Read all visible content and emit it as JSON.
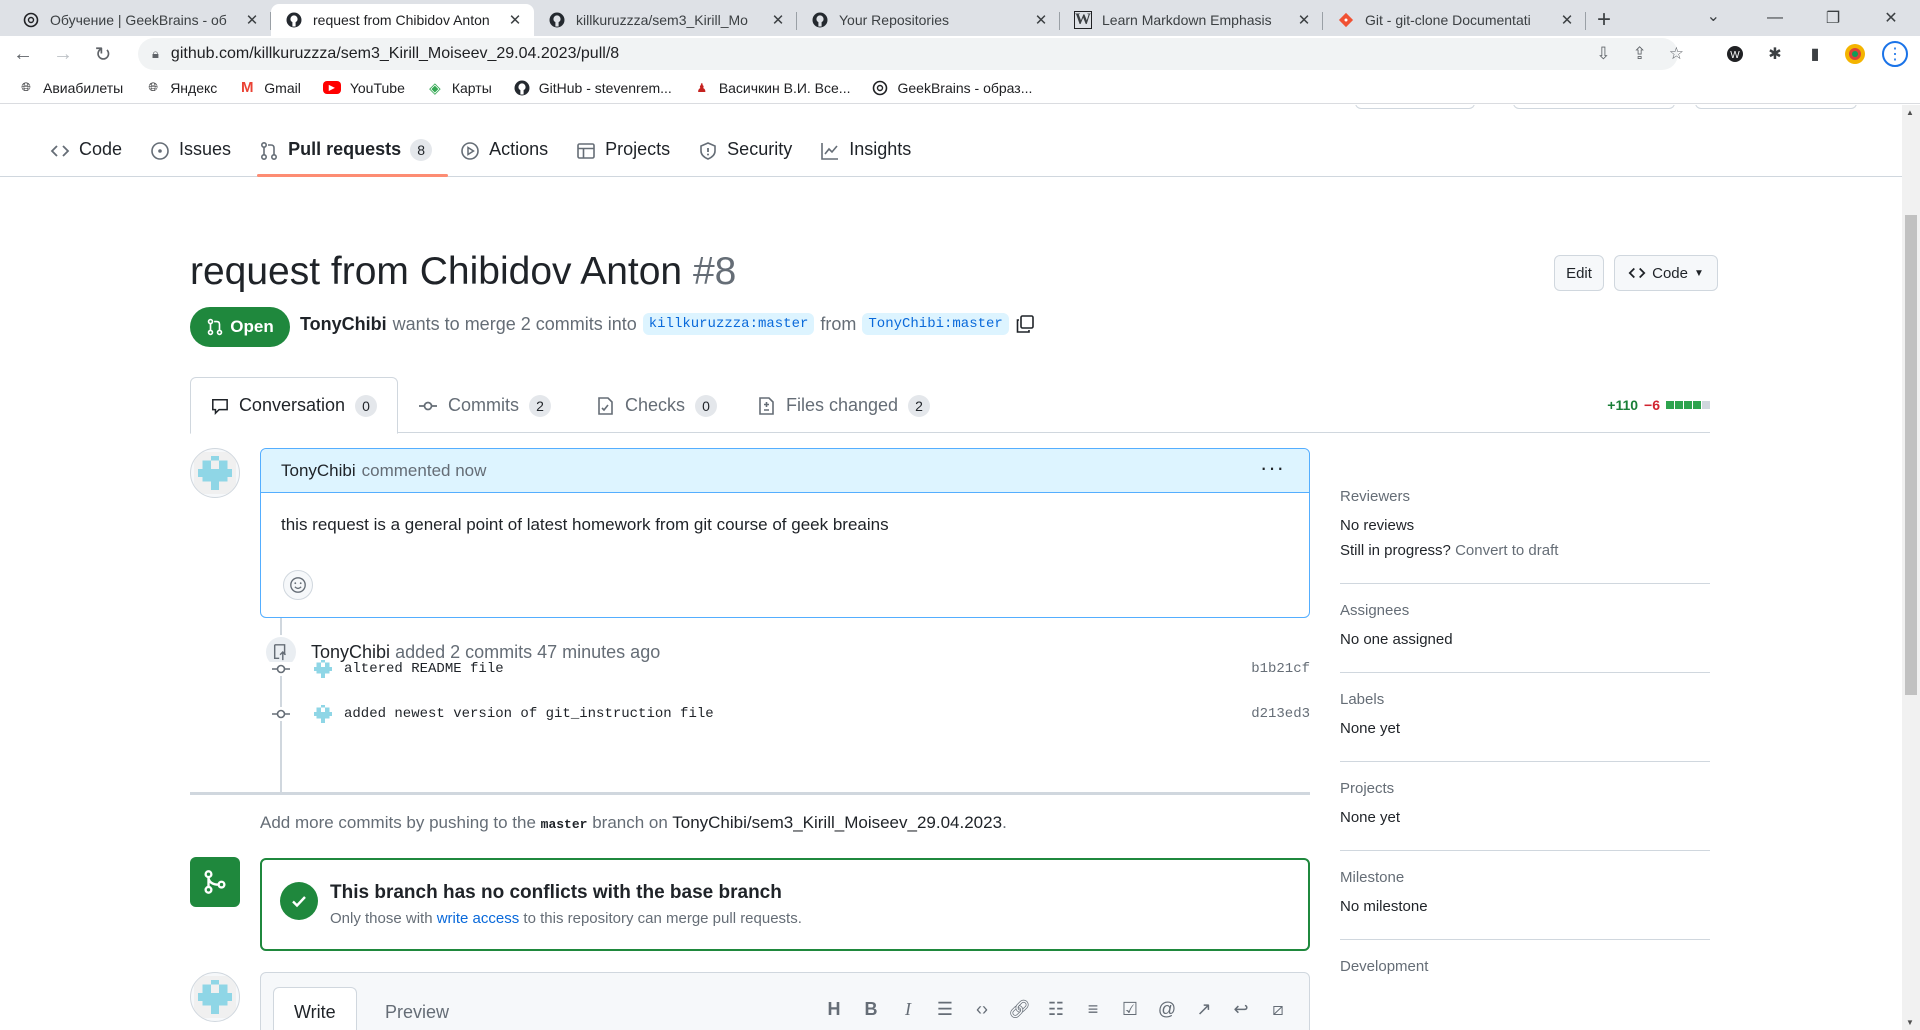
{
  "browser": {
    "tabs": [
      {
        "title": "Обучение | GeekBrains - об",
        "icon": "openai-icon"
      },
      {
        "title": "request from Chibidov Anton",
        "icon": "github-icon",
        "active": true
      },
      {
        "title": "killkuruzzza/sem3_Kirill_Mo",
        "icon": "github-icon"
      },
      {
        "title": "Your Repositories",
        "icon": "github-icon"
      },
      {
        "title": "Learn Markdown Emphasis",
        "icon": "w-icon"
      },
      {
        "title": "Git - git-clone Documentati",
        "icon": "git-icon"
      }
    ],
    "url": "github.com/killkuruzzza/sem3_Kirill_Moiseev_29.04.2023/pull/8",
    "bookmarks": [
      {
        "label": "Авиабилеты",
        "icon": "globe-icon"
      },
      {
        "label": "Яндекс",
        "icon": "globe-icon"
      },
      {
        "label": "Gmail",
        "icon": "gmail-icon"
      },
      {
        "label": "YouTube",
        "icon": "youtube-icon"
      },
      {
        "label": "Карты",
        "icon": "maps-icon"
      },
      {
        "label": "GitHub - stevenrem...",
        "icon": "github-icon"
      },
      {
        "label": "Васичкин В.И. Все...",
        "icon": "person-icon"
      },
      {
        "label": "GeekBrains - образ...",
        "icon": "openai-icon"
      }
    ]
  },
  "repo_nav": {
    "code": "Code",
    "issues": "Issues",
    "pulls": "Pull requests",
    "pulls_count": "8",
    "actions": "Actions",
    "projects": "Projects",
    "security": "Security",
    "insights": "Insights"
  },
  "pr": {
    "title": "request from Chibidov Anton",
    "number": "#8",
    "edit_label": "Edit",
    "code_label": "Code",
    "state": "Open",
    "author": "TonyChibi",
    "merge_text": "wants to merge 2 commits into",
    "base_branch": "killkuruzzza:master",
    "from_text": "from",
    "head_branch": "TonyChibi:master"
  },
  "pr_tabs": {
    "conversation": "Conversation",
    "conversation_count": "0",
    "commits": "Commits",
    "commits_count": "2",
    "checks": "Checks",
    "checks_count": "0",
    "files": "Files changed",
    "files_count": "2",
    "additions": "+110",
    "deletions": "−6",
    "diff_blocks_green": 4,
    "diff_blocks_total": 5
  },
  "comment": {
    "author": "TonyChibi",
    "action": "commented now",
    "body": "this request is a general point of latest homework from git course of geek breains"
  },
  "push_event": {
    "author": "TonyChibi",
    "text": "added 2 commits 47 minutes ago",
    "commits": [
      {
        "message": "altered README file",
        "sha": "b1b21cf"
      },
      {
        "message": "added newest version of git_instruction file",
        "sha": "d213ed3"
      }
    ]
  },
  "add_more": {
    "prefix": "Add more commits by pushing to the",
    "branch": "master",
    "middle": "branch on",
    "repo": "TonyChibi/sem3_Kirill_Moiseev_29.04.2023",
    "suffix": "."
  },
  "merge": {
    "title": "This branch has no conflicts with the base branch",
    "desc_prefix": "Only those with",
    "desc_link": "write access",
    "desc_suffix": "to this repository can merge pull requests."
  },
  "composer": {
    "write": "Write",
    "preview": "Preview"
  },
  "sidebar": {
    "reviewers": "Reviewers",
    "reviewers_value": "No reviews",
    "in_progress": "Still in progress?",
    "convert_draft": "Convert to draft",
    "assignees": "Assignees",
    "assignees_value": "No one assigned",
    "labels": "Labels",
    "labels_value": "None yet",
    "projects": "Projects",
    "projects_value": "None yet",
    "milestone": "Milestone",
    "milestone_value": "No milestone",
    "development": "Development"
  },
  "colors": {
    "open_green": "#1f883d",
    "accent_blue": "#0969da",
    "tab_underline": "#fd8c73"
  }
}
